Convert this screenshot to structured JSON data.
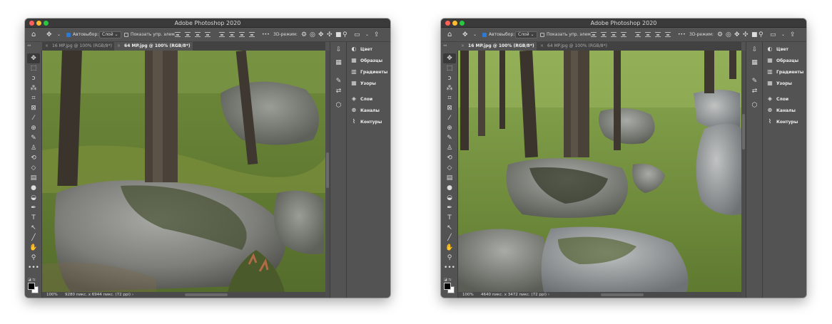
{
  "windows": [
    {
      "title": "Adobe Photoshop 2020",
      "options": {
        "autoselect_label": "Автовыбор:",
        "autoselect_value": "Слой",
        "show_transform_label": "Показать упр. элем.",
        "more": "•••",
        "mode_3d_label": "3D-режим:"
      },
      "tabs": [
        {
          "label": "16 MP.jpg @ 100% (RGB/8*)",
          "close": "×",
          "active": false
        },
        {
          "label": "64 MP.jpg @ 100% (RGB/8*)",
          "close": "×",
          "active": true
        }
      ],
      "status": {
        "zoom": "100%",
        "dimensions": "9280 пикс. x 6944 пикс. (72 ppi)",
        "arrow": "›"
      },
      "panels": {
        "group1": [
          "Цвет",
          "Образцы",
          "Градиенты",
          "Узоры"
        ],
        "group2": [
          "Слои",
          "Каналы",
          "Контуры"
        ]
      },
      "scroll_thumb_fraction": 0.48
    },
    {
      "title": "Adobe Photoshop 2020",
      "options": {
        "autoselect_label": "Автовыбор:",
        "autoselect_value": "Слой",
        "show_transform_label": "Показать упр. элем.",
        "more": "•••",
        "mode_3d_label": "3D-режим:"
      },
      "tabs": [
        {
          "label": "16 MP.jpg @ 100% (RGB/8*)",
          "close": "×",
          "active": true
        },
        {
          "label": "64 MP.jpg @ 100% (RGB/8*)",
          "close": "×",
          "active": false
        }
      ],
      "status": {
        "zoom": "100%",
        "dimensions": "4640 пикс. x 3472 пикс. (72 ppi)",
        "arrow": "›"
      },
      "panels": {
        "group1": [
          "Цвет",
          "Образцы",
          "Градиенты",
          "Узоры"
        ],
        "group2": [
          "Слои",
          "Каналы",
          "Контуры"
        ]
      },
      "scroll_thumb_fraction": 0.3
    }
  ],
  "colors": {
    "window_bg": "#535353",
    "title_bar": "#3a3a3a",
    "accent": "#2d7ad6"
  }
}
